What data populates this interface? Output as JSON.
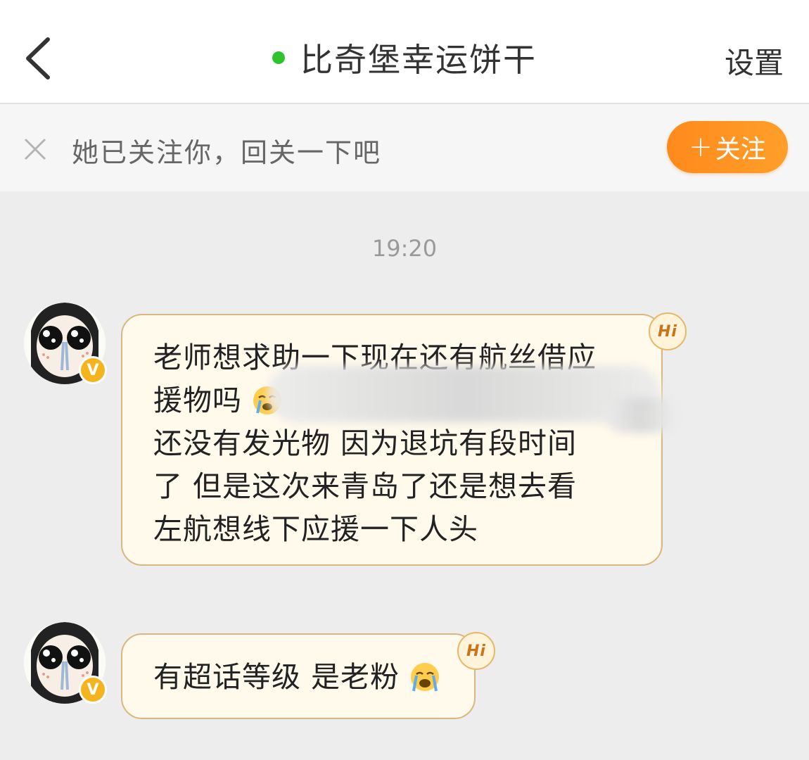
{
  "header": {
    "title": "比奇堡幸运饼干",
    "settings_label": "设置",
    "online_status_color": "#2ec42e"
  },
  "follow_prompt": {
    "text": "她已关注你，回关一下吧",
    "button_label": "关注",
    "button_plus": "+"
  },
  "messages": {
    "timestamp": "19:20",
    "msg1": {
      "line1": "老师想求助一下现在还有航丝借应",
      "line2": "援物吗",
      "line3": "还没有发光物 因为退坑有段时间",
      "line4": "了 但是这次来青岛了还是想去看",
      "line5": "左航想线下应援一下人头",
      "emoji": "crying-face-icon"
    },
    "msg2": {
      "text": "有超话等级 是老粉",
      "emoji": "crying-face-icon"
    },
    "badge_label": "Hi",
    "verified_label": "V"
  },
  "colors": {
    "accent": "#ff8a1c",
    "bubble_bg": "#fffaec",
    "bubble_border": "#d9b682",
    "verified": "#f5b41e"
  }
}
